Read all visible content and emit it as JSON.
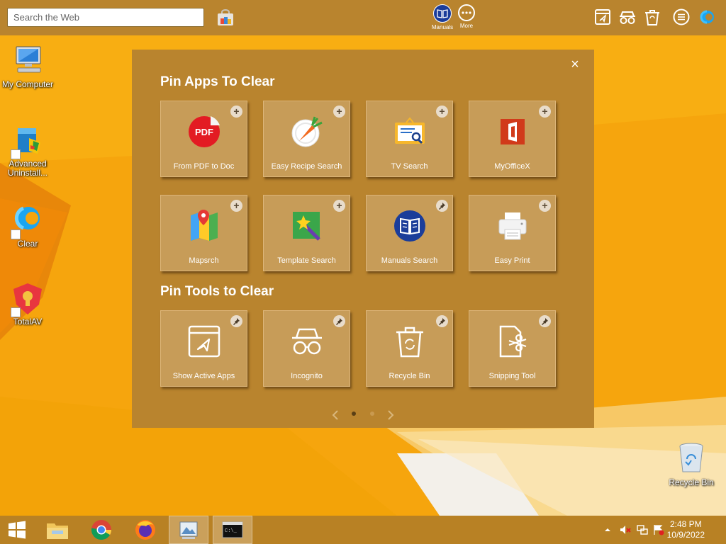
{
  "colors": {
    "toolbar_bg": "#b9842e",
    "panel_bg": "#b9842e",
    "tile_bg": "#c79c58",
    "wallpaper_orange": "#f5a20a",
    "taskbar_bg": "#b88124"
  },
  "topbar": {
    "search_placeholder": "Search the Web",
    "buttons": [
      {
        "label": "Manuals",
        "icon": "book-icon"
      },
      {
        "label": "More",
        "icon": "more-dots-icon"
      }
    ],
    "right_icons": [
      "show-active-apps-icon",
      "incognito-icon",
      "recycle-bin-icon",
      "menu-icon",
      "clear-logo-icon"
    ]
  },
  "desktop": {
    "icons": [
      {
        "label": "My Computer",
        "icon": "computer-icon"
      },
      {
        "label": "Advanced Uninstall...",
        "icon": "installer-icon"
      },
      {
        "label": "Clear",
        "icon": "clear-logo-icon"
      },
      {
        "label": "TotalAV",
        "icon": "shield-icon"
      },
      {
        "label": "Recycle Bin",
        "icon": "recycle-bin-icon"
      }
    ]
  },
  "panel": {
    "apps_title": "Pin Apps To Clear",
    "tools_title": "Pin Tools to Clear",
    "close_symbol": "×",
    "apps": [
      {
        "label": "From PDF to Doc",
        "icon": "pdf-icon",
        "pinned": false
      },
      {
        "label": "Easy Recipe Search",
        "icon": "carrot-plate-icon",
        "pinned": false
      },
      {
        "label": "TV Search",
        "icon": "tv-search-icon",
        "pinned": false
      },
      {
        "label": "MyOfficeX",
        "icon": "office-icon",
        "pinned": false
      },
      {
        "label": "Mapsrch",
        "icon": "map-pin-icon",
        "pinned": false
      },
      {
        "label": "Template Search",
        "icon": "magic-wand-icon",
        "pinned": false
      },
      {
        "label": "Manuals Search",
        "icon": "book-icon",
        "pinned": true
      },
      {
        "label": "Easy Print",
        "icon": "printer-icon",
        "pinned": false
      }
    ],
    "tools": [
      {
        "label": "Show Active Apps",
        "icon": "show-active-apps-icon",
        "pinned": true
      },
      {
        "label": "Incognito",
        "icon": "incognito-icon",
        "pinned": true
      },
      {
        "label": "Recycle Bin",
        "icon": "recycle-bin-icon",
        "pinned": true
      },
      {
        "label": "Snipping Tool",
        "icon": "scissors-icon",
        "pinned": true
      }
    ],
    "pager": {
      "pages": 2,
      "current": 1
    }
  },
  "taskbar": {
    "items": [
      "windows-start-icon",
      "file-explorer-icon",
      "chrome-icon",
      "firefox-icon",
      "image-viewer-icon",
      "command-prompt-icon"
    ],
    "clock_time": "2:48 PM",
    "clock_date": "10/9/2022"
  }
}
